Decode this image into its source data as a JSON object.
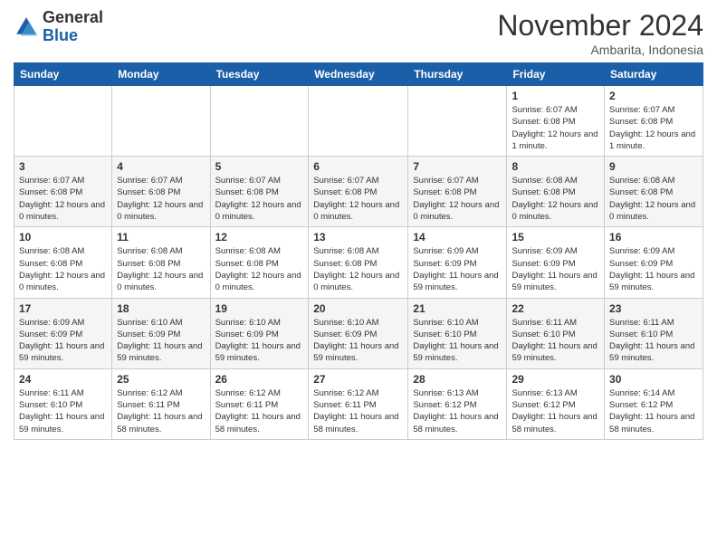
{
  "header": {
    "logo_general": "General",
    "logo_blue": "Blue",
    "month_title": "November 2024",
    "location": "Ambarita, Indonesia"
  },
  "days_of_week": [
    "Sunday",
    "Monday",
    "Tuesday",
    "Wednesday",
    "Thursday",
    "Friday",
    "Saturday"
  ],
  "weeks": [
    [
      {
        "day": "",
        "info": ""
      },
      {
        "day": "",
        "info": ""
      },
      {
        "day": "",
        "info": ""
      },
      {
        "day": "",
        "info": ""
      },
      {
        "day": "",
        "info": ""
      },
      {
        "day": "1",
        "info": "Sunrise: 6:07 AM\nSunset: 6:08 PM\nDaylight: 12 hours and 1 minute."
      },
      {
        "day": "2",
        "info": "Sunrise: 6:07 AM\nSunset: 6:08 PM\nDaylight: 12 hours and 1 minute."
      }
    ],
    [
      {
        "day": "3",
        "info": "Sunrise: 6:07 AM\nSunset: 6:08 PM\nDaylight: 12 hours and 0 minutes."
      },
      {
        "day": "4",
        "info": "Sunrise: 6:07 AM\nSunset: 6:08 PM\nDaylight: 12 hours and 0 minutes."
      },
      {
        "day": "5",
        "info": "Sunrise: 6:07 AM\nSunset: 6:08 PM\nDaylight: 12 hours and 0 minutes."
      },
      {
        "day": "6",
        "info": "Sunrise: 6:07 AM\nSunset: 6:08 PM\nDaylight: 12 hours and 0 minutes."
      },
      {
        "day": "7",
        "info": "Sunrise: 6:07 AM\nSunset: 6:08 PM\nDaylight: 12 hours and 0 minutes."
      },
      {
        "day": "8",
        "info": "Sunrise: 6:08 AM\nSunset: 6:08 PM\nDaylight: 12 hours and 0 minutes."
      },
      {
        "day": "9",
        "info": "Sunrise: 6:08 AM\nSunset: 6:08 PM\nDaylight: 12 hours and 0 minutes."
      }
    ],
    [
      {
        "day": "10",
        "info": "Sunrise: 6:08 AM\nSunset: 6:08 PM\nDaylight: 12 hours and 0 minutes."
      },
      {
        "day": "11",
        "info": "Sunrise: 6:08 AM\nSunset: 6:08 PM\nDaylight: 12 hours and 0 minutes."
      },
      {
        "day": "12",
        "info": "Sunrise: 6:08 AM\nSunset: 6:08 PM\nDaylight: 12 hours and 0 minutes."
      },
      {
        "day": "13",
        "info": "Sunrise: 6:08 AM\nSunset: 6:08 PM\nDaylight: 12 hours and 0 minutes."
      },
      {
        "day": "14",
        "info": "Sunrise: 6:09 AM\nSunset: 6:09 PM\nDaylight: 11 hours and 59 minutes."
      },
      {
        "day": "15",
        "info": "Sunrise: 6:09 AM\nSunset: 6:09 PM\nDaylight: 11 hours and 59 minutes."
      },
      {
        "day": "16",
        "info": "Sunrise: 6:09 AM\nSunset: 6:09 PM\nDaylight: 11 hours and 59 minutes."
      }
    ],
    [
      {
        "day": "17",
        "info": "Sunrise: 6:09 AM\nSunset: 6:09 PM\nDaylight: 11 hours and 59 minutes."
      },
      {
        "day": "18",
        "info": "Sunrise: 6:10 AM\nSunset: 6:09 PM\nDaylight: 11 hours and 59 minutes."
      },
      {
        "day": "19",
        "info": "Sunrise: 6:10 AM\nSunset: 6:09 PM\nDaylight: 11 hours and 59 minutes."
      },
      {
        "day": "20",
        "info": "Sunrise: 6:10 AM\nSunset: 6:09 PM\nDaylight: 11 hours and 59 minutes."
      },
      {
        "day": "21",
        "info": "Sunrise: 6:10 AM\nSunset: 6:10 PM\nDaylight: 11 hours and 59 minutes."
      },
      {
        "day": "22",
        "info": "Sunrise: 6:11 AM\nSunset: 6:10 PM\nDaylight: 11 hours and 59 minutes."
      },
      {
        "day": "23",
        "info": "Sunrise: 6:11 AM\nSunset: 6:10 PM\nDaylight: 11 hours and 59 minutes."
      }
    ],
    [
      {
        "day": "24",
        "info": "Sunrise: 6:11 AM\nSunset: 6:10 PM\nDaylight: 11 hours and 59 minutes."
      },
      {
        "day": "25",
        "info": "Sunrise: 6:12 AM\nSunset: 6:11 PM\nDaylight: 11 hours and 58 minutes."
      },
      {
        "day": "26",
        "info": "Sunrise: 6:12 AM\nSunset: 6:11 PM\nDaylight: 11 hours and 58 minutes."
      },
      {
        "day": "27",
        "info": "Sunrise: 6:12 AM\nSunset: 6:11 PM\nDaylight: 11 hours and 58 minutes."
      },
      {
        "day": "28",
        "info": "Sunrise: 6:13 AM\nSunset: 6:12 PM\nDaylight: 11 hours and 58 minutes."
      },
      {
        "day": "29",
        "info": "Sunrise: 6:13 AM\nSunset: 6:12 PM\nDaylight: 11 hours and 58 minutes."
      },
      {
        "day": "30",
        "info": "Sunrise: 6:14 AM\nSunset: 6:12 PM\nDaylight: 11 hours and 58 minutes."
      }
    ]
  ]
}
